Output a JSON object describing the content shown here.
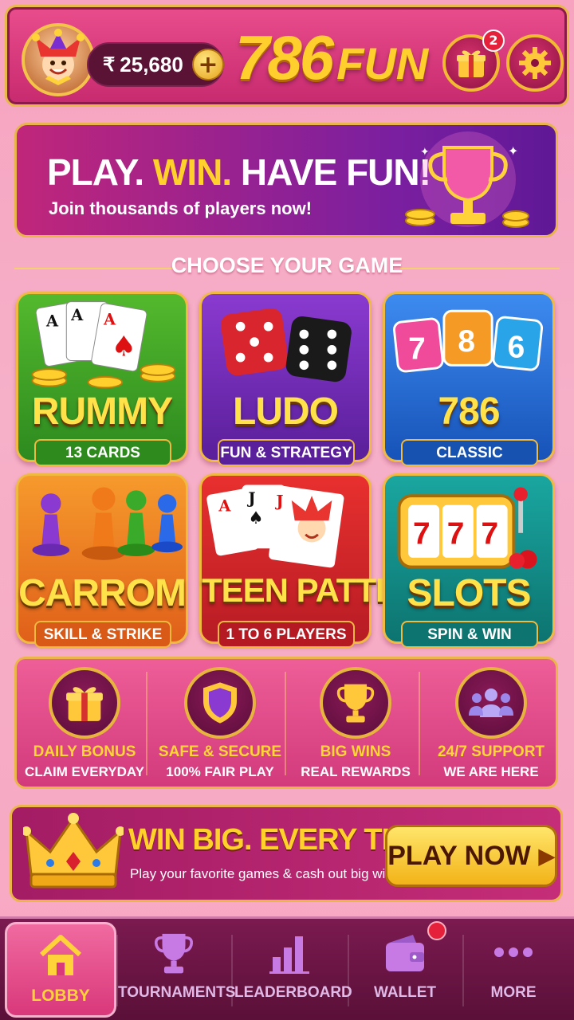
{
  "header": {
    "balance": "25,680",
    "currency_symbol": "₹",
    "add_label": "+",
    "logo_number": "786",
    "logo_text": "FUN",
    "gift_badge_count": "2"
  },
  "banner": {
    "title_part1": "PLAY.",
    "title_part2": "WIN.",
    "title_part3": "HAVE FUN!",
    "subtitle": "Join thousands of players now!"
  },
  "section_title": "CHOOSE YOUR GAME",
  "games": [
    {
      "name": "RUMMY",
      "subtitle": "13 CARDS",
      "color": "#3fa12a"
    },
    {
      "name": "LUDO",
      "subtitle": "FUN & STRATEGY",
      "color": "#6a2bb0"
    },
    {
      "name": "786",
      "subtitle": "CLASSIC",
      "color": "#1e63c9"
    },
    {
      "name": "CARROM",
      "subtitle": "SKILL & STRIKE",
      "color": "#ef7a1a"
    },
    {
      "name": "TEEN PATTI",
      "subtitle": "1 TO 6 PLAYERS",
      "color": "#cf1f2c"
    },
    {
      "name": "SLOTS",
      "subtitle": "SPIN & WIN",
      "color": "#0f8b86"
    }
  ],
  "features": [
    {
      "title": "DAILY BONUS",
      "subtitle": "CLAIM EVERYDAY",
      "icon": "gift-icon"
    },
    {
      "title": "SAFE & SECURE",
      "subtitle": "100% FAIR PLAY",
      "icon": "shield-icon"
    },
    {
      "title": "BIG WINS",
      "subtitle": "REAL REWARDS",
      "icon": "trophy-icon"
    },
    {
      "title": "24/7 SUPPORT",
      "subtitle": "WE ARE HERE",
      "icon": "users-icon"
    }
  ],
  "promo": {
    "title": "WIN BIG. EVERY TIME.",
    "subtitle": "Play your favorite games & cash out big wins!",
    "button_label": "PLAY NOW"
  },
  "nav": [
    {
      "label": "LOBBY",
      "icon": "home-icon"
    },
    {
      "label": "TOURNAMENTS",
      "icon": "trophy-icon"
    },
    {
      "label": "LEADERBOARD",
      "icon": "bar-chart-icon"
    },
    {
      "label": "WALLET",
      "icon": "wallet-icon"
    },
    {
      "label": "MORE",
      "icon": "more-icon"
    }
  ],
  "colors": {
    "accent_gold": "#ffd84a",
    "primary_pink": "#e24684",
    "nav_bg": "#6a1445"
  }
}
